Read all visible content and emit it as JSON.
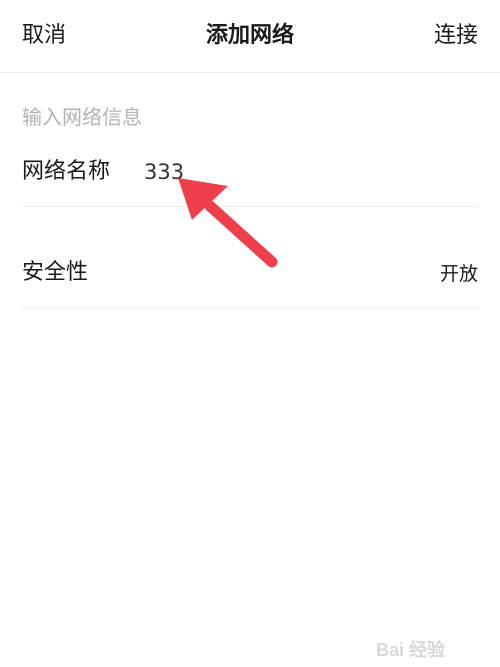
{
  "nav": {
    "cancel_label": "取消",
    "title": "添加网络",
    "connect_label": "连接"
  },
  "form": {
    "section_header": "输入网络信息",
    "network_name_label": "网络名称",
    "network_name_value": "333",
    "security_label": "安全性",
    "security_value": "开放"
  },
  "annotation": {
    "arrow_color": "#ef3f4a"
  },
  "watermark": {
    "text": "Bai 经验",
    "icon": "baidu-paw-icon"
  }
}
